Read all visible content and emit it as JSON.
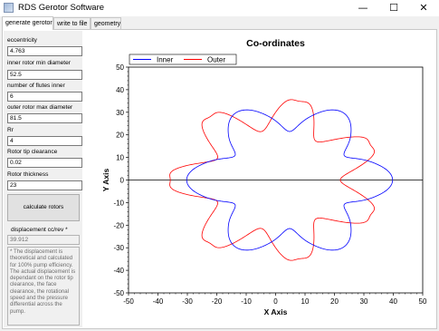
{
  "window": {
    "title": "RDS Gerotor Software",
    "controls": {
      "minimize": "—",
      "maximize": "☐",
      "close": "✕"
    }
  },
  "tabs": [
    {
      "label": "generate gerotor",
      "active": true
    },
    {
      "label": "write to file",
      "active": false
    },
    {
      "label": "geometry",
      "active": false
    }
  ],
  "form": {
    "eccentricity": {
      "label": "eccentricity",
      "value": "4.763"
    },
    "inner_min_diameter": {
      "label": "inner rotor min diameter",
      "value": "52.5"
    },
    "flutes_inner": {
      "label": "number of flutes inner",
      "value": "6"
    },
    "outer_max_diameter": {
      "label": "outer rotor max diameter",
      "value": "81.5"
    },
    "rr": {
      "label": "Rr",
      "value": "4"
    },
    "tip_clearance": {
      "label": "Rotor tip clearance",
      "value": "0.02"
    },
    "thickness": {
      "label": "Rotor thickness",
      "value": "23"
    },
    "calculate_button": "calculate rotors",
    "displacement": {
      "label": "displacement cc/rev *",
      "value": "39.912"
    },
    "note": "* The displacement is theoretical and calculated for 100% pump efficiency. The actual displacement is dependant on the rotor tip clearance, the face clearance, the rotational speed and the pressure differential across the pump."
  },
  "chart_data": {
    "type": "line",
    "title": "Co-ordinates",
    "xlabel": "X Axis",
    "ylabel": "Y Axis",
    "xlim": [
      -50,
      50
    ],
    "ylim": [
      -50,
      50
    ],
    "xticks": [
      -50,
      -40,
      -30,
      -20,
      -10,
      0,
      10,
      20,
      30,
      40,
      50
    ],
    "yticks": [
      -50,
      -40,
      -30,
      -20,
      -10,
      0,
      10,
      20,
      30,
      40,
      50
    ],
    "legend_position": "top-left",
    "grid": false,
    "series": [
      {
        "name": "Inner",
        "color": "#0000ff",
        "shape": "6-lobe gerotor inner rotor, min diameter 52.5, centre offset (4.763, 0)"
      },
      {
        "name": "Outer",
        "color": "#ff0000",
        "shape": "7-lobe gerotor outer rotor, max diameter 81.5, centred at origin"
      }
    ]
  }
}
